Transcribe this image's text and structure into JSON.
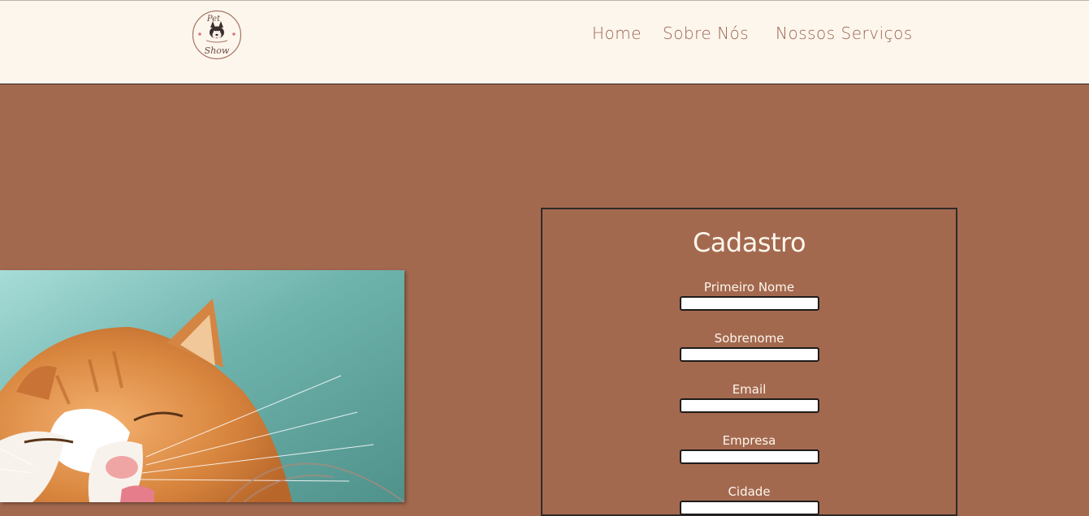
{
  "header": {
    "logo": {
      "text_top": "Pet",
      "text_bottom": "Show",
      "icon": "dog-face-icon"
    },
    "nav": [
      {
        "label": "Home"
      },
      {
        "label": "Sobre Nós"
      },
      {
        "label": "Nossos Serviços"
      }
    ]
  },
  "hero": {
    "image": "orange-tabby-cat-yawning-photo"
  },
  "form": {
    "title": "Cadastro",
    "fields": [
      {
        "label": "Primeiro Nome",
        "value": ""
      },
      {
        "label": "Sobrenome",
        "value": ""
      },
      {
        "label": "Email",
        "value": ""
      },
      {
        "label": "Empresa",
        "value": ""
      },
      {
        "label": "Cidade",
        "value": ""
      }
    ]
  },
  "colors": {
    "background": "#a3694f",
    "header_bg": "#fdf6ec",
    "nav_text": "#9c6452",
    "form_text": "#fdf6ec",
    "form_border": "#2f2a28"
  }
}
